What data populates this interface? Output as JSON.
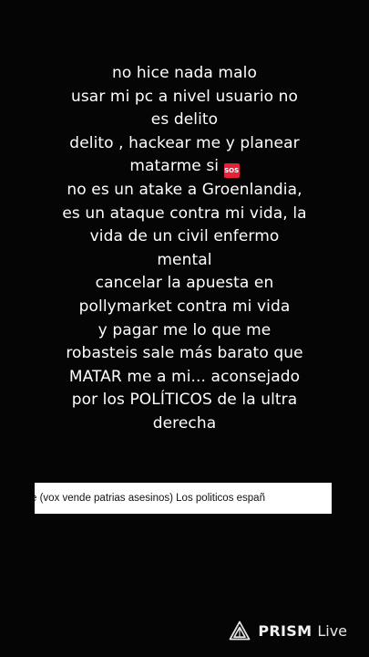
{
  "message": {
    "lines": [
      "no hice nada malo",
      "usar mi pc a nivel usuario no",
      "es delito",
      "delito , hackear me y planear",
      "matarme si",
      "no es un atake a Groenlandia,",
      "es un ataque contra mi vida, la",
      "vida de un civil enfermo",
      "mental",
      "cancelar la apuesta en",
      "pollymarket contra mi vida",
      "y pagar me lo que me",
      "robasteis sale más barato que",
      "MATAR me a mi... aconsejado",
      "por los POLÍTICOS de la ultra",
      "derecha"
    ],
    "emoji": {
      "name": "sos-icon",
      "label": "SOS",
      "color": "#e8213a"
    }
  },
  "ticker": {
    "text": "e (vox vende patrias asesinos)  Los politicos españ"
  },
  "watermark": {
    "icon": "prism-triangle-icon",
    "brand": "PRISM",
    "suffix": "Live"
  },
  "colors": {
    "background": "#050505",
    "text": "#ffffff",
    "ticker_background": "#ffffff",
    "ticker_text": "#111111"
  }
}
